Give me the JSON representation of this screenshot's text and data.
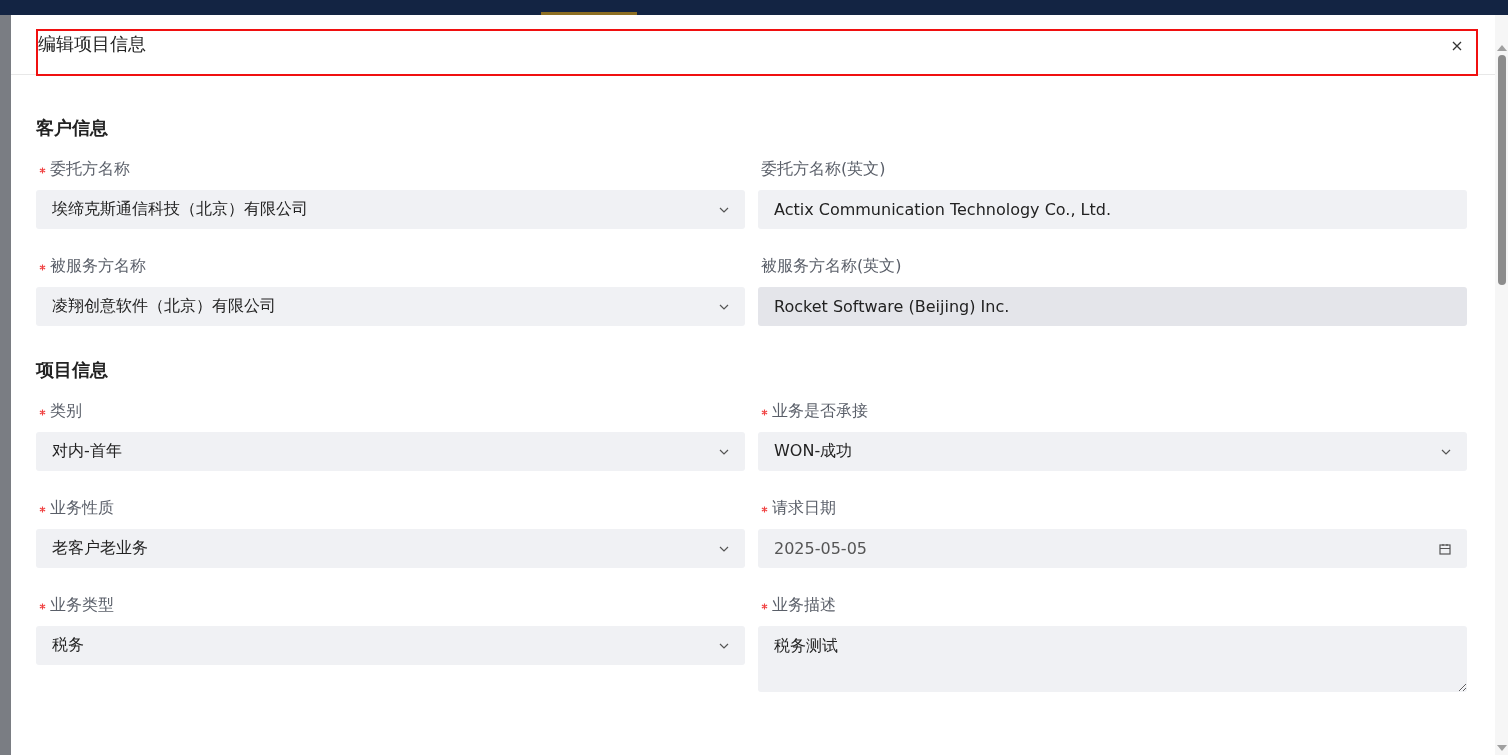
{
  "dialog": {
    "title": "编辑项目信息",
    "highlighted": true
  },
  "sections": [
    {
      "title": "客户信息",
      "fields": [
        {
          "label": "委托方名称",
          "required": true,
          "kind": "select",
          "value": "埃缔克斯通信科技（北京）有限公司"
        },
        {
          "label": "委托方名称(英文)",
          "required": false,
          "kind": "text",
          "value": "Actix Communication Technology Co., Ltd."
        },
        {
          "label": "被服务方名称",
          "required": true,
          "kind": "select",
          "value": "凌翔创意软件（北京）有限公司"
        },
        {
          "label": "被服务方名称(英文)",
          "required": false,
          "kind": "readonly",
          "value": "Rocket Software (Beijing) Inc."
        }
      ]
    },
    {
      "title": "项目信息",
      "fields": [
        {
          "label": "类别",
          "required": true,
          "kind": "select",
          "value": "对内-首年"
        },
        {
          "label": "业务是否承接",
          "required": true,
          "kind": "select",
          "value": "WON-成功"
        },
        {
          "label": "业务性质",
          "required": true,
          "kind": "select",
          "value": "老客户老业务"
        },
        {
          "label": "请求日期",
          "required": true,
          "kind": "date",
          "value": "2025-05-05"
        },
        {
          "label": "业务类型",
          "required": true,
          "kind": "select",
          "value": "税务"
        },
        {
          "label": "业务描述",
          "required": true,
          "kind": "textarea",
          "value": "税务测试"
        }
      ]
    }
  ]
}
